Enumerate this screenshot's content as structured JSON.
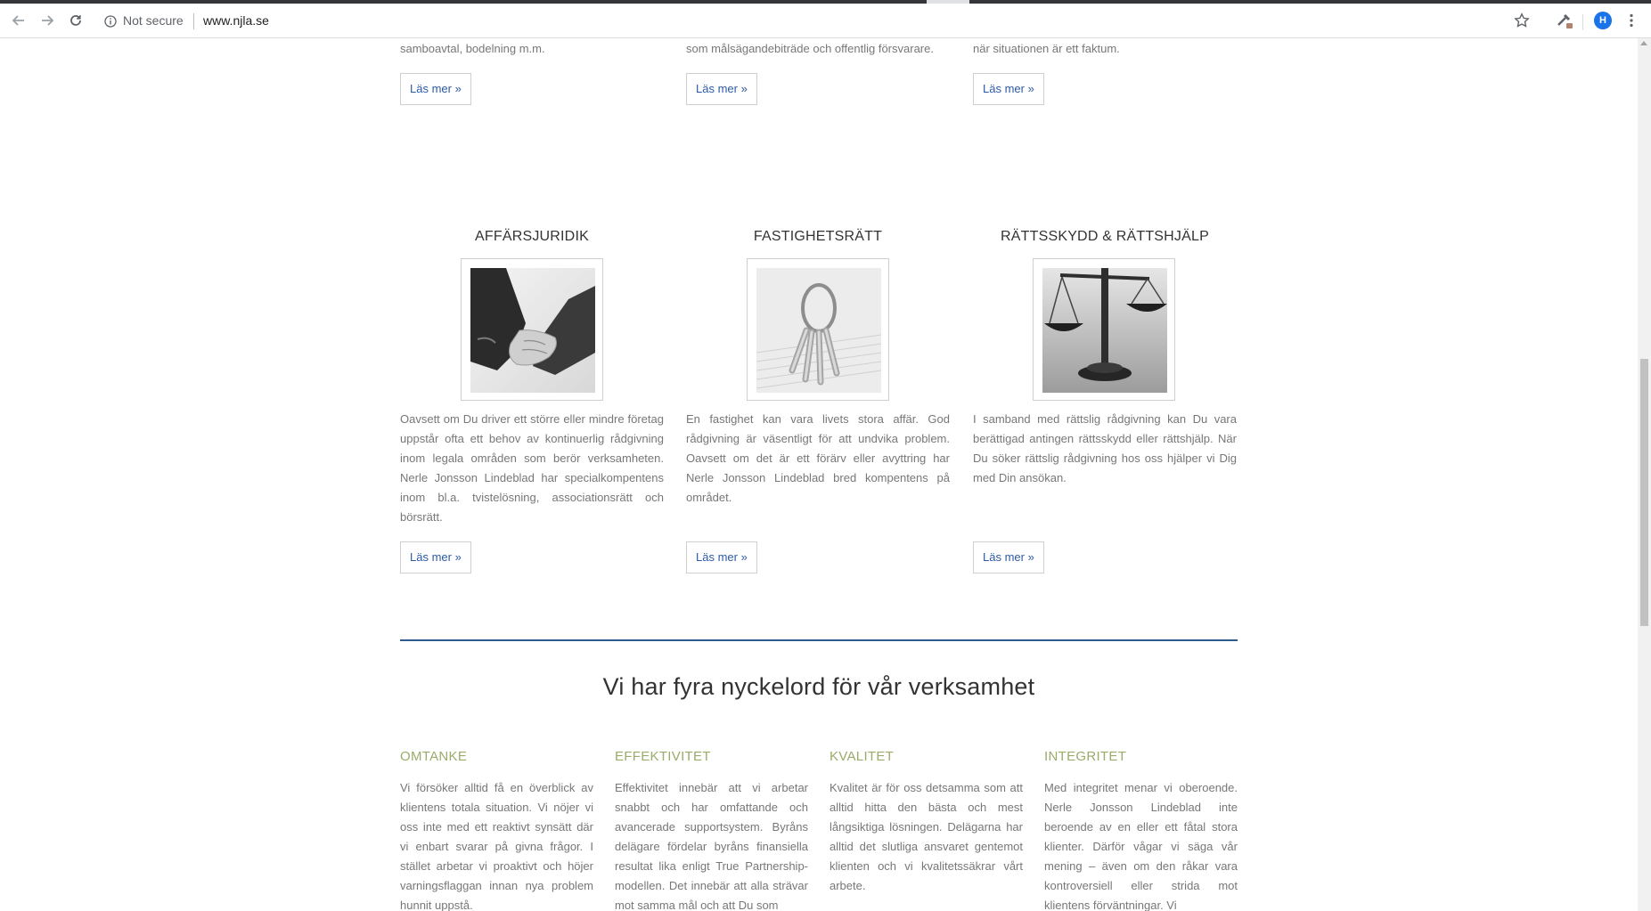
{
  "browser": {
    "security_label": "Not secure",
    "url": "www.njla.se",
    "avatar_letter": "H"
  },
  "top_row": {
    "items": [
      {
        "text_tail": "samboavtal, bodelning m.m.",
        "button": "Läs mer »"
      },
      {
        "text_tail": "som målsägandebiträde och offentlig försvarare.",
        "button": "Läs mer »"
      },
      {
        "text_tail": "när situationen är ett faktum.",
        "button": "Läs mer »"
      }
    ]
  },
  "services": [
    {
      "title": "AFFÄRSJURIDIK",
      "image_icon": "handshake-image",
      "text": "Oavsett om Du driver ett större eller mindre företag uppstår ofta ett behov av kontinuerlig rådgivning inom legala områden som berör verksamheten. Nerle Jonsson Lindeblad har specialkompentens inom bl.a. tvistelösning, associationsrätt och börsrätt.",
      "button": "Läs mer »"
    },
    {
      "title": "FASTIGHETSRÄTT",
      "image_icon": "keys-image",
      "text": "En fastighet kan vara livets stora affär. God rådgivning är väsentligt för att undvika problem. Oavsett om det är ett förärv eller avyttring har Nerle Jonsson Lindeblad bred kompentens på området.",
      "button": "Läs mer »"
    },
    {
      "title": "RÄTTSSKYDD & RÄTTSHJÄLP",
      "image_icon": "scales-image",
      "text": "I samband med rättslig rådgivning kan Du vara berättigad antingen rättsskydd eller rättshjälp. När Du söker rättslig rådgivning hos oss hjälper vi Dig med Din ansökan.",
      "button": "Läs mer »"
    }
  ],
  "keywords": {
    "heading": "Vi har fyra nyckelord för vår verksamhet",
    "items": [
      {
        "title": "OMTANKE",
        "text": "Vi försöker alltid få en överblick av klientens totala situation. Vi nöjer vi oss inte med ett reaktivt synsätt där vi enbart svarar på givna frågor. I stället arbetar vi proaktivt och höjer varningsflaggan innan nya problem hunnit uppstå."
      },
      {
        "title": "EFFEKTIVITET",
        "text": "Effektivitet innebär att vi arbetar snabbt och har omfattande och avancerade supportsystem. Byråns delägare fördelar byråns finansiella resultat lika enligt True Partnership-modellen. Det innebär att alla strävar mot samma mål och att Du som"
      },
      {
        "title": "KVALITET",
        "text": "Kvalitet är för oss detsamma som att alltid hitta den bästa och mest långsiktiga lösningen. Delägarna har alltid det slutliga ansvaret gentemot klienten och vi kvalitetssäkrar vårt arbete."
      },
      {
        "title": "INTEGRITET",
        "text": "Med integritet menar vi oberoende. Nerle Jonsson Lindeblad inte beroende av en eller ett fåtal stora klienter. Därför vågar vi säga vår mening – även om den råkar vara kontroversiell eller strida mot klientens förväntningar. Vi"
      }
    ]
  },
  "colors": {
    "link_blue": "#2a5aa7",
    "keyword_green": "#9aab6a",
    "divider_blue": "#2d5d8f"
  }
}
